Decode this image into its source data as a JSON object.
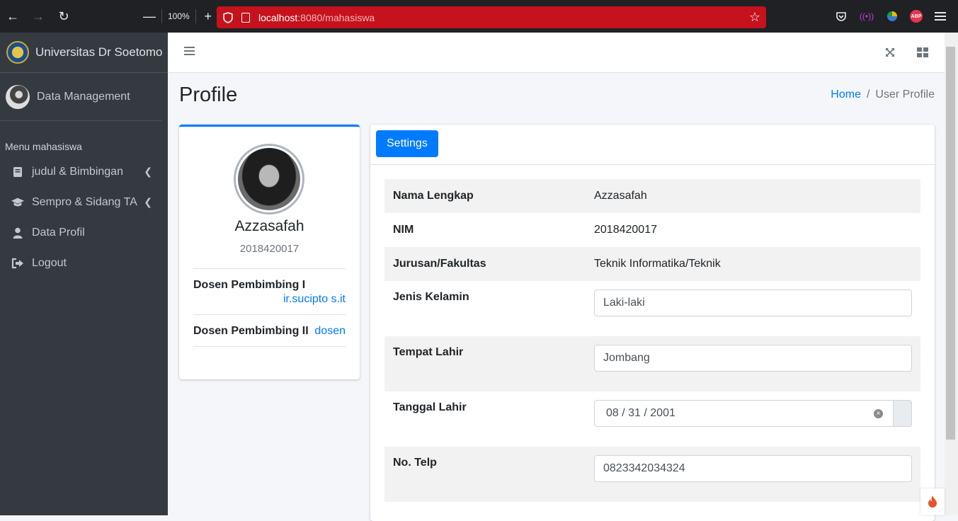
{
  "browser": {
    "zoom": "100%",
    "url_host": "localhost",
    "url_path": ":8080/mahasiswa"
  },
  "sidebar": {
    "brand": "Universitas Dr Soetomo",
    "user": "Data Management",
    "menu_header": "Menu mahasiswa",
    "items": [
      {
        "label": "judul & Bimbingan",
        "icon": "book-icon",
        "has_caret": true
      },
      {
        "label": "Sempro & Sidang TA",
        "icon": "graduation-cap-icon",
        "has_caret": true
      },
      {
        "label": "Data Profil",
        "icon": "user-icon",
        "has_caret": false
      },
      {
        "label": "Logout",
        "icon": "sign-out-icon",
        "has_caret": false
      }
    ]
  },
  "page": {
    "title": "Profile",
    "breadcrumb": {
      "home": "Home",
      "separator": "/",
      "current": "User Profile"
    }
  },
  "profile": {
    "name": "Azzasafah",
    "nim": "2018420017",
    "dosen1_label": "Dosen Pembimbing I",
    "dosen1_value": "ir.sucipto s.it",
    "dosen2_label": "Dosen Pembimbing II",
    "dosen2_value": "dosen"
  },
  "settings": {
    "tab_label": "Settings",
    "rows": {
      "nama_label": "Nama Lengkap",
      "nama_value": "Azzasafah",
      "nim_label": "NIM",
      "nim_value": "2018420017",
      "jurusan_label": "Jurusan/Fakultas",
      "jurusan_value": "Teknik Informatika/Teknik",
      "jk_label": "Jenis Kelamin",
      "jk_value": "Laki-laki",
      "tempat_label": "Tempat Lahir",
      "tempat_value": "Jombang",
      "tanggal_label": "Tanggal Lahir",
      "tanggal_value": "08 / 31 / 2001",
      "telp_label": "No. Telp",
      "telp_value": "0823342034324"
    }
  },
  "colors": {
    "primary": "#007bff",
    "sidebar_bg": "#343a40",
    "url_bar": "#c5121c"
  }
}
